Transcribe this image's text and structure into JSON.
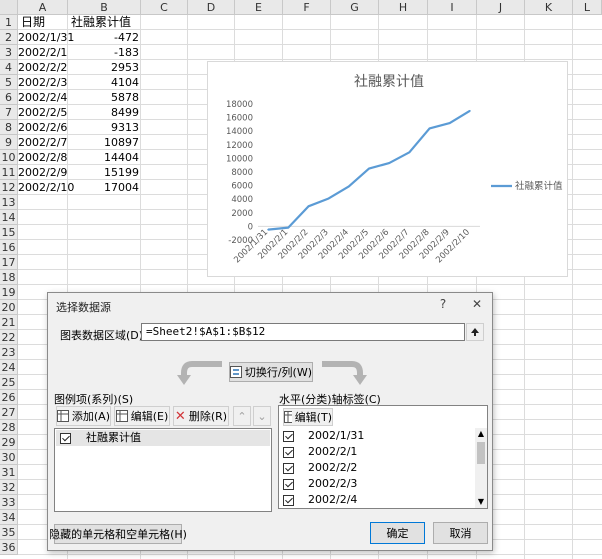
{
  "sheet": {
    "columns": [
      "A",
      "B",
      "C",
      "D",
      "E",
      "F",
      "G",
      "H",
      "I",
      "J",
      "K",
      "L"
    ],
    "rows": [
      "1",
      "2",
      "3",
      "4",
      "5",
      "6",
      "7",
      "8",
      "9",
      "10",
      "11",
      "12",
      "13",
      "14",
      "15",
      "16",
      "17",
      "18",
      "19",
      "20",
      "21",
      "22",
      "23",
      "24",
      "25",
      "26",
      "27",
      "28",
      "29",
      "30",
      "31",
      "32",
      "33",
      "34",
      "35",
      "36"
    ],
    "header_a": "日期",
    "header_b": "社融累计值",
    "data": [
      {
        "date": "2002/1/31",
        "value": "-472"
      },
      {
        "date": "2002/2/1",
        "value": "-183"
      },
      {
        "date": "2002/2/2",
        "value": "2953"
      },
      {
        "date": "2002/2/3",
        "value": "4104"
      },
      {
        "date": "2002/2/4",
        "value": "5878"
      },
      {
        "date": "2002/2/5",
        "value": "8499"
      },
      {
        "date": "2002/2/6",
        "value": "9313"
      },
      {
        "date": "2002/2/7",
        "value": "10897"
      },
      {
        "date": "2002/2/8",
        "value": "14404"
      },
      {
        "date": "2002/2/9",
        "value": "15199"
      },
      {
        "date": "2002/2/10",
        "value": "17004"
      }
    ]
  },
  "chart_data": {
    "type": "line",
    "title": "社融累计值",
    "categories": [
      "2002/1/31",
      "2002/2/1",
      "2002/2/2",
      "2002/2/3",
      "2002/2/4",
      "2002/2/5",
      "2002/2/6",
      "2002/2/7",
      "2002/2/8",
      "2002/2/9",
      "2002/2/10"
    ],
    "series": [
      {
        "name": "社融累计值",
        "values": [
          -472,
          -183,
          2953,
          4104,
          5878,
          8499,
          9313,
          10897,
          14404,
          15199,
          17004
        ]
      }
    ],
    "yticks": [
      "-2000",
      "0",
      "2000",
      "4000",
      "6000",
      "8000",
      "10000",
      "12000",
      "14000",
      "16000",
      "18000"
    ],
    "ylim": [
      -2000,
      18000
    ],
    "grid": false,
    "legend": "right",
    "line_color": "#5b9bd5"
  },
  "dialog": {
    "title": "选择数据源",
    "help": "?",
    "close": "✕",
    "range_label": "图表数据区域(D):",
    "range_value": "=Sheet2!$A$1:$B$12",
    "switch_label": "切换行/列(W)",
    "legend_label": "图例项(系列)(S)",
    "add_label": "添加(A)",
    "edit_label": "编辑(E)",
    "delete_label": "删除(R)",
    "series_items": [
      "社融累计值"
    ],
    "axis_label": "水平(分类)轴标签(C)",
    "axis_edit_label": "编辑(T)",
    "axis_items": [
      "2002/1/31",
      "2002/2/1",
      "2002/2/2",
      "2002/2/3",
      "2002/2/4"
    ],
    "hidden_label": "隐藏的单元格和空单元格(H)",
    "ok_label": "确定",
    "cancel_label": "取消"
  }
}
